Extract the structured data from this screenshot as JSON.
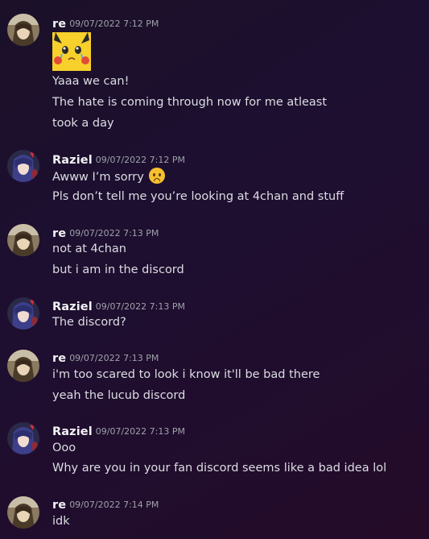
{
  "messages": [
    {
      "author": "re",
      "timestamp": "09/07/2022 7:12 PM",
      "sticker": "pikachu-crying-sticker",
      "lines": [
        "Yaaa we can!",
        "The hate is coming through now for me atleast",
        "took a day"
      ]
    },
    {
      "author": "Raziel",
      "timestamp": "09/07/2022 7:12 PM",
      "lines": [
        "Awww I’m sorry",
        "Pls don’t tell me you’re looking at 4chan and stuff"
      ],
      "emoji": "frowning-face-icon"
    },
    {
      "author": "re",
      "timestamp": "09/07/2022 7:13 PM",
      "lines": [
        "not at 4chan",
        "but i am in the discord"
      ]
    },
    {
      "author": "Raziel",
      "timestamp": "09/07/2022 7:13 PM",
      "lines": [
        "The discord?"
      ]
    },
    {
      "author": "re",
      "timestamp": "09/07/2022 7:13 PM",
      "lines": [
        "i'm too scared to look i know it'll be bad there",
        "yeah the lucub discord"
      ]
    },
    {
      "author": "Raziel",
      "timestamp": "09/07/2022 7:13 PM",
      "lines": [
        "Ooo",
        "Why are you in your fan discord seems like a bad idea lol"
      ]
    },
    {
      "author": "re",
      "timestamp": "09/07/2022 7:14 PM",
      "lines": [
        "idk"
      ]
    }
  ],
  "colors": {
    "author": "#f2f3f5",
    "timestamp": "#9fa2ab",
    "text": "#dcdde3"
  }
}
